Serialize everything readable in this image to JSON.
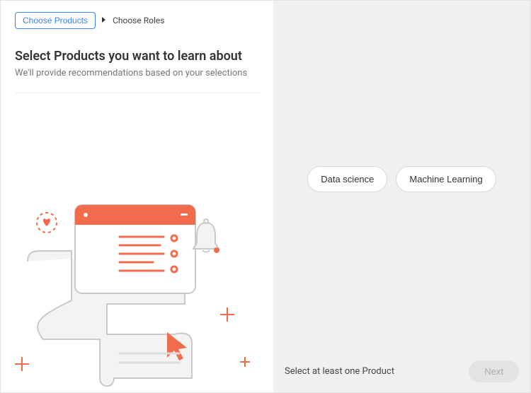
{
  "breadcrumb": {
    "current": "Choose Products",
    "next": "Choose Roles"
  },
  "header": {
    "title": "Select Products you want to learn about",
    "subtitle": "We'll provide recommendations based on your selections"
  },
  "chips": {
    "0": {
      "label": "Data science"
    },
    "1": {
      "label": "Machine Learning"
    }
  },
  "footer": {
    "message": "Select at least one Product",
    "next": "Next"
  },
  "colors": {
    "accent": "#f16c4d",
    "accent_light": "#f7a48f",
    "line": "#d9d9d9",
    "dark": "#333333"
  }
}
